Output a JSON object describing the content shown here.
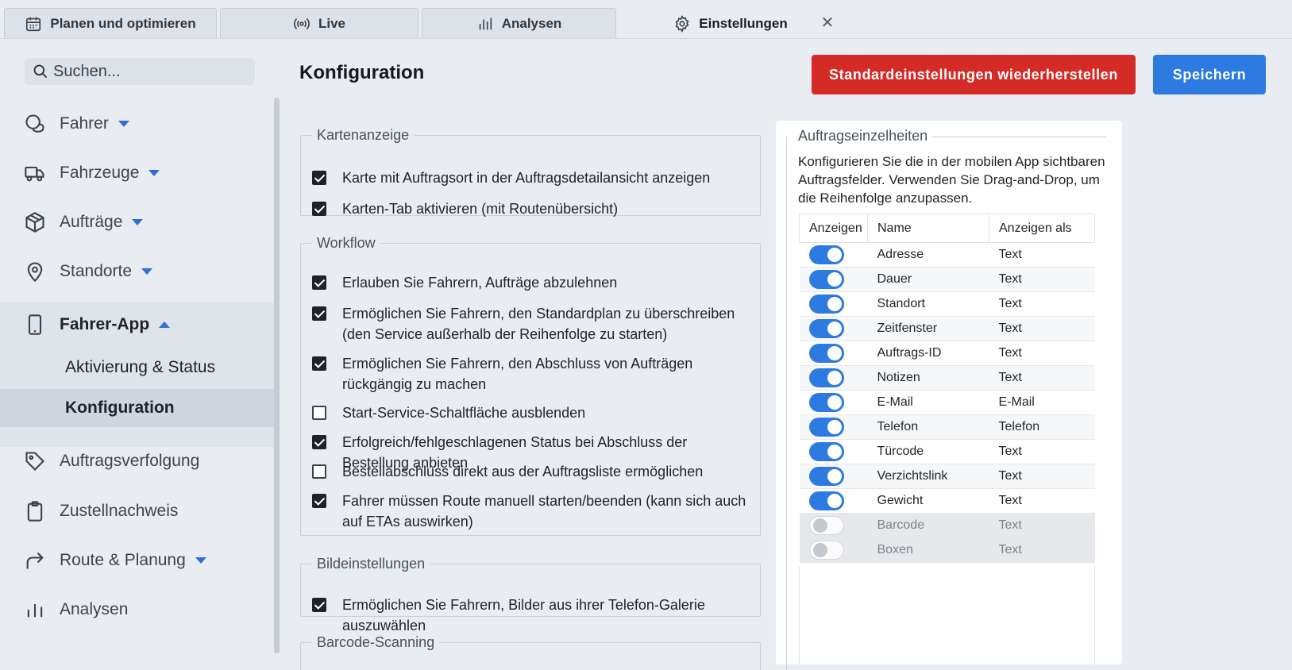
{
  "tabs": [
    {
      "label": "Planen und optimieren",
      "icon": "calendar-icon"
    },
    {
      "label": "Live",
      "icon": "broadcast-icon"
    },
    {
      "label": "Analysen",
      "icon": "bar-chart-icon"
    },
    {
      "label": "Einstellungen",
      "icon": "gear-icon",
      "active": true
    }
  ],
  "search": {
    "placeholder": "Suchen..."
  },
  "sidebar": {
    "items": [
      {
        "label": "Fahrer",
        "icon": "driver-icon",
        "expandable": true
      },
      {
        "label": "Fahrzeuge",
        "icon": "truck-icon",
        "expandable": true
      },
      {
        "label": "Aufträge",
        "icon": "package-icon",
        "expandable": true
      },
      {
        "label": "Standorte",
        "icon": "location-pin-icon",
        "expandable": true
      },
      {
        "label": "Fahrer-App",
        "icon": "phone-icon",
        "expanded": true
      },
      {
        "label": "Auftragsverfolgung",
        "icon": "tag-icon"
      },
      {
        "label": "Zustellnachweis",
        "icon": "clipboard-icon"
      },
      {
        "label": "Route & Planung",
        "icon": "route-arrow-icon",
        "expandable": true
      },
      {
        "label": "Analysen",
        "icon": "bar-chart-icon"
      }
    ],
    "subitems": [
      {
        "label": "Aktivierung & Status"
      },
      {
        "label": "Konfiguration",
        "active": true
      }
    ]
  },
  "main": {
    "title": "Konfiguration",
    "reset_label": "Standardeinstellungen wiederherstellen",
    "save_label": "Speichern",
    "groups": [
      {
        "legend": "Kartenanzeige",
        "options": [
          {
            "label": "Karte mit Auftragsort in der Auftragsdetailansicht anzeigen",
            "checked": true
          },
          {
            "label": "Karten-Tab aktivieren (mit Routenübersicht)",
            "checked": true
          }
        ]
      },
      {
        "legend": "Workflow",
        "options": [
          {
            "label": "Erlauben Sie Fahrern, Aufträge abzulehnen",
            "checked": true
          },
          {
            "label": "Ermöglichen Sie Fahrern, den Standardplan zu überschreiben (den Service außerhalb der Reihenfolge zu starten)",
            "checked": true
          },
          {
            "label": "Ermöglichen Sie Fahrern, den Abschluss von Aufträgen rückgängig zu machen",
            "checked": true
          },
          {
            "label": "Start-Service-Schaltfläche ausblenden",
            "checked": false
          },
          {
            "label": "Erfolgreich/fehlgeschlagenen Status bei Abschluss der Bestellung anbieten",
            "checked": true
          },
          {
            "label": "Bestellabschluss direkt aus der Auftragsliste ermöglichen",
            "checked": false
          },
          {
            "label": "Fahrer müssen Route manuell starten/beenden (kann sich auch auf ETAs auswirken)",
            "checked": true
          }
        ]
      },
      {
        "legend": "Bildeinstellungen",
        "options": [
          {
            "label": "Ermöglichen Sie Fahrern, Bilder aus ihrer Telefon-Galerie auszuwählen",
            "checked": true
          }
        ]
      },
      {
        "legend": "Barcode-Scanning",
        "options": []
      }
    ]
  },
  "details": {
    "legend": "Auftragseinzelheiten",
    "description": "Konfigurieren Sie die in der mobilen App sichtbaren Auftragsfelder. Verwenden Sie Drag-and-Drop, um die Reihenfolge anzupassen.",
    "columns": [
      "Anzeigen",
      "Name",
      "Anzeigen als"
    ],
    "rows": [
      {
        "show": true,
        "name": "Adresse",
        "as": "Text"
      },
      {
        "show": true,
        "name": "Dauer",
        "as": "Text"
      },
      {
        "show": true,
        "name": "Standort",
        "as": "Text"
      },
      {
        "show": true,
        "name": "Zeitfenster",
        "as": "Text"
      },
      {
        "show": true,
        "name": "Auftrags-ID",
        "as": "Text"
      },
      {
        "show": true,
        "name": "Notizen",
        "as": "Text"
      },
      {
        "show": true,
        "name": "E-Mail",
        "as": "E-Mail"
      },
      {
        "show": true,
        "name": "Telefon",
        "as": "Telefon"
      },
      {
        "show": true,
        "name": "Türcode",
        "as": "Text"
      },
      {
        "show": true,
        "name": "Verzichtslink",
        "as": "Text"
      },
      {
        "show": true,
        "name": "Gewicht",
        "as": "Text"
      },
      {
        "show": false,
        "name": "Barcode",
        "as": "Text"
      },
      {
        "show": false,
        "name": "Boxen",
        "as": "Text"
      }
    ]
  },
  "colors": {
    "accent": "#2d7be0",
    "danger": "#d52b27",
    "background": "#e9ecf1"
  }
}
